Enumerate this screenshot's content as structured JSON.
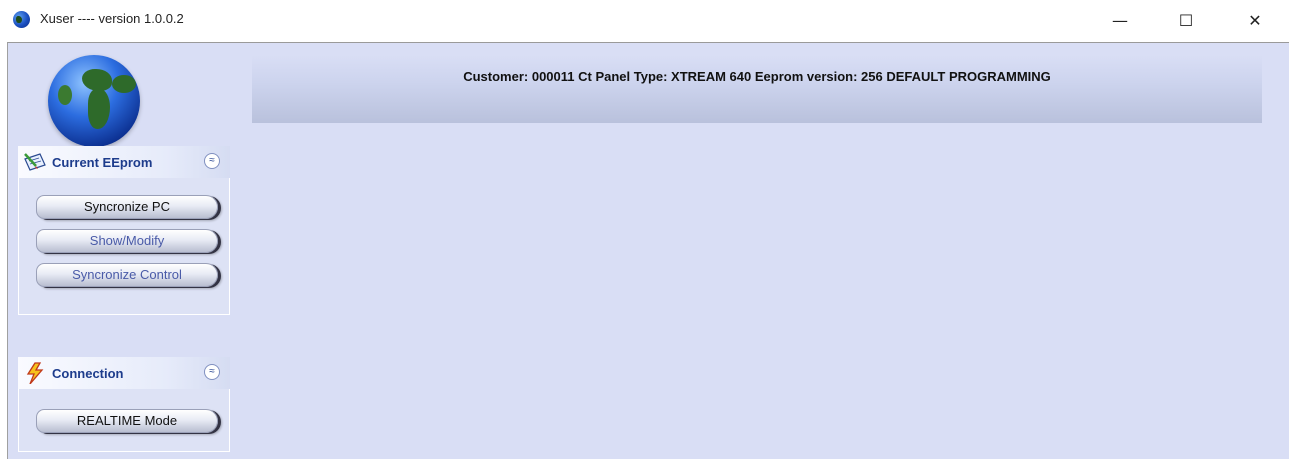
{
  "window": {
    "title": "Xuser ---- version 1.0.0.2",
    "controls": {
      "minimize": "—",
      "maximize": "☐",
      "close": "✕"
    }
  },
  "banner": {
    "text": "Customer: 000011 Ct Panel Type: XTREAM 640 Eeprom version: 256  DEFAULT PROGRAMMING"
  },
  "panels": {
    "current_eeprom": {
      "title": "Current EEprom",
      "icon": "notebook-icon",
      "collapse": "≈",
      "buttons": [
        {
          "label": "Syncronize PC",
          "enabled": true
        },
        {
          "label": "Show/Modify",
          "enabled": false
        },
        {
          "label": "Syncronize Control",
          "enabled": false
        }
      ]
    },
    "connection": {
      "title": "Connection",
      "icon": "lightning-icon",
      "collapse": "≈",
      "buttons": [
        {
          "label": "REALTIME Mode",
          "enabled": true
        }
      ]
    }
  },
  "colors": {
    "client_bg": "#d9def5",
    "panel_title": "#1d3c8c",
    "disabled_text": "#4a5ba8"
  }
}
